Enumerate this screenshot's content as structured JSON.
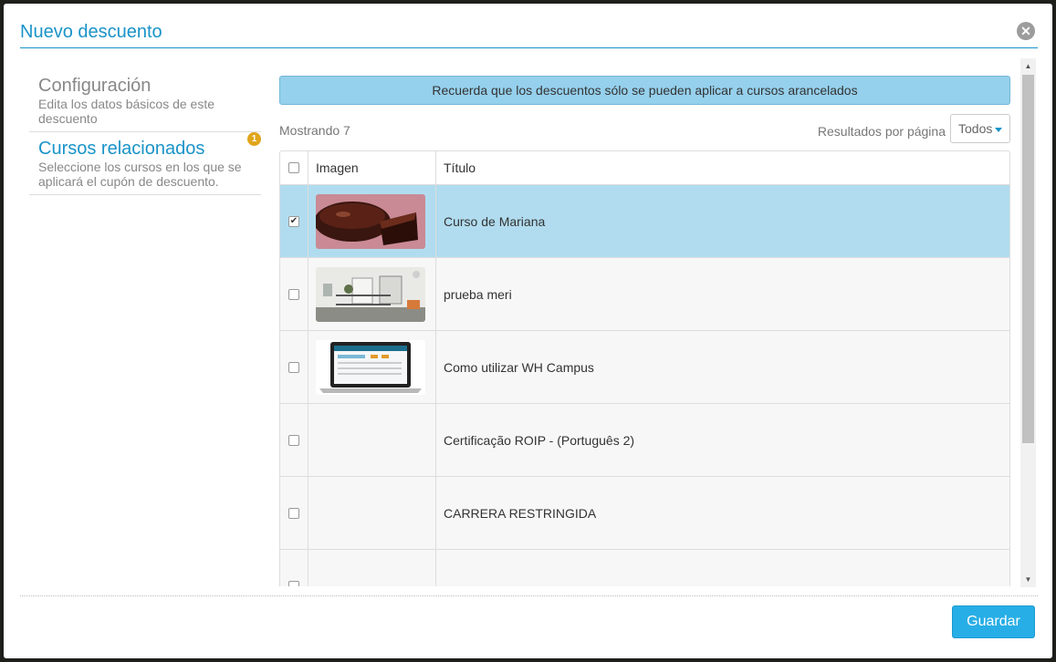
{
  "modal": {
    "title": "Nuevo descuento",
    "close_glyph": "✕",
    "save_label": "Guardar"
  },
  "nav": {
    "items": [
      {
        "title": "Configuración",
        "description": "Edita los datos básicos de este descuento"
      },
      {
        "title": "Cursos relacionados",
        "description": "Seleccione los cursos en los que se aplicará el cupón de descuento.",
        "badge": "1"
      }
    ]
  },
  "content": {
    "alert": "Recuerda que los descuentos sólo se pueden aplicar a cursos arancelados",
    "showing": "Mostrando 7",
    "per_page_label": "Resultados por página",
    "per_page_value": "Todos"
  },
  "table": {
    "headers": {
      "image": "Imagen",
      "title": "Título"
    },
    "rows": [
      {
        "title": "Curso de Mariana",
        "checked": true
      },
      {
        "title": "prueba meri",
        "checked": false
      },
      {
        "title": "Como utilizar WH Campus",
        "checked": false
      },
      {
        "title": "Certificação ROIP - (Português 2)",
        "checked": false
      },
      {
        "title": "CARRERA RESTRINGIDA",
        "checked": false
      },
      {
        "title": "",
        "checked": false
      }
    ]
  },
  "colors": {
    "accent": "#1a93c8",
    "alert_bg": "#95d0ec",
    "selected_row": "#b1dcef",
    "badge": "#e0a51b",
    "save_button": "#27aee6"
  },
  "icons": {
    "close": "close-icon",
    "caret": "caret-down-icon",
    "check": "checkmark-icon"
  }
}
